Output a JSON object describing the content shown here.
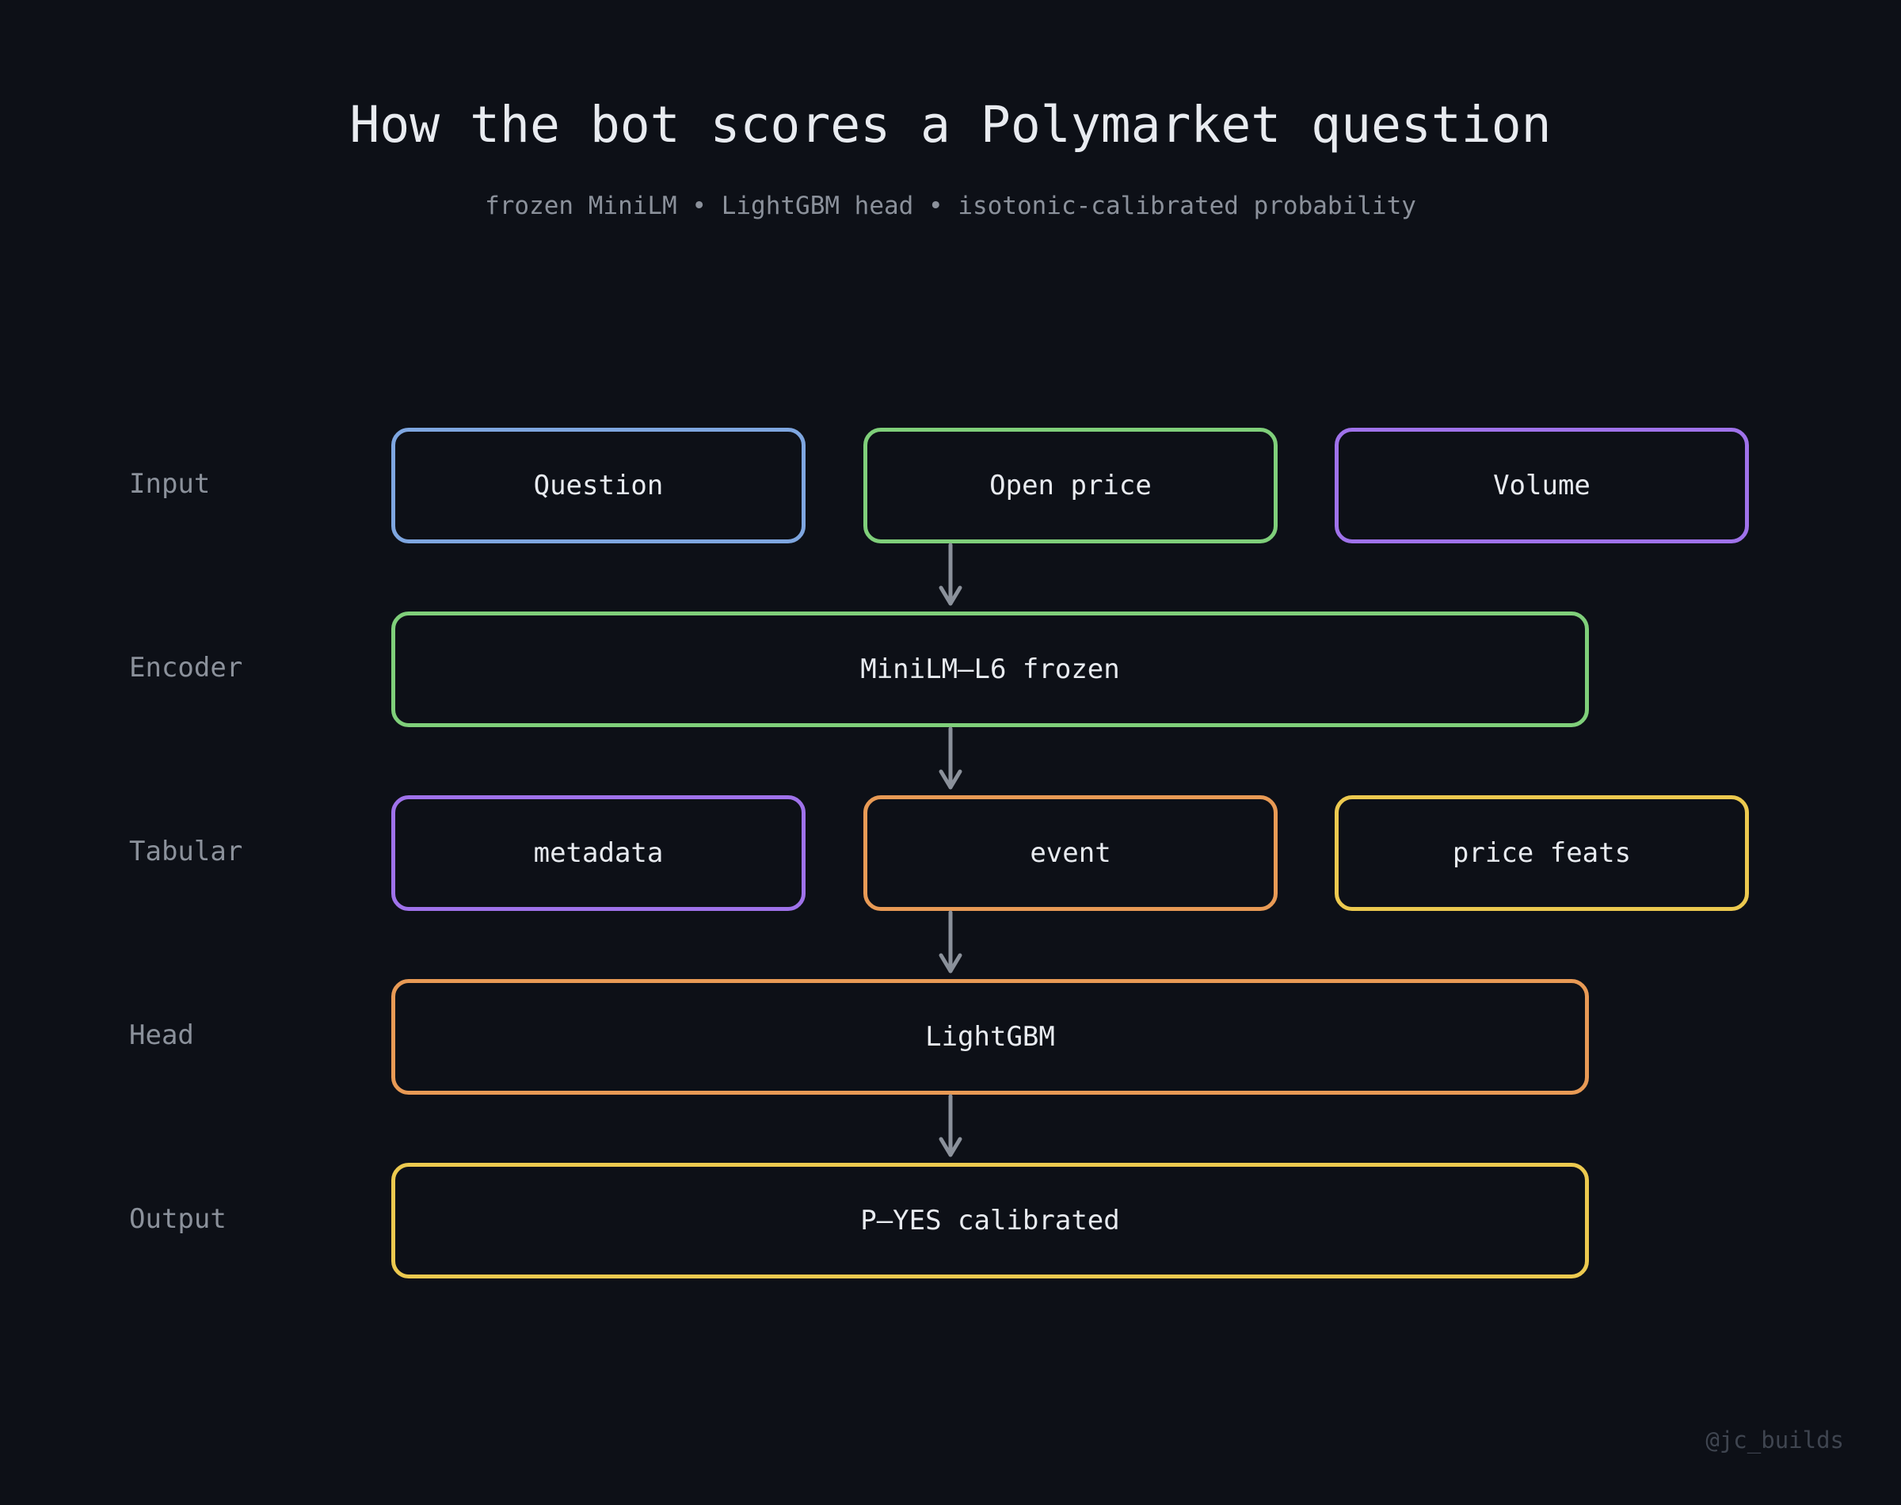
{
  "header": {
    "title": "How the bot scores a Polymarket question",
    "subtitle": "frozen MiniLM • LightGBM head • isotonic-calibrated probability"
  },
  "rows": {
    "input": {
      "label": "Input",
      "nodes": [
        {
          "label": "Question",
          "color": "#7ea6e0"
        },
        {
          "label": "Open price",
          "color": "#7fcf7a"
        },
        {
          "label": "Volume",
          "color": "#9f72ea"
        }
      ]
    },
    "encoder": {
      "label": "Encoder",
      "node": {
        "label": "MiniLM–L6 frozen",
        "color": "#7fcf7a"
      }
    },
    "tabular": {
      "label": "Tabular",
      "nodes": [
        {
          "label": "metadata",
          "color": "#9f72ea"
        },
        {
          "label": "event",
          "color": "#e89a55"
        },
        {
          "label": "price feats",
          "color": "#ecc94f"
        }
      ]
    },
    "head": {
      "label": "Head",
      "node": {
        "label": "LightGBM",
        "color": "#e89a55"
      }
    },
    "output": {
      "label": "Output",
      "node": {
        "label": "P–YES calibrated",
        "color": "#ecc94f"
      }
    }
  },
  "colors": {
    "background": "#0d1017",
    "arrow": "#8b919b",
    "text": "#e8ebf0",
    "muted_text": "#8b919b"
  },
  "watermark": "@jc_builds"
}
